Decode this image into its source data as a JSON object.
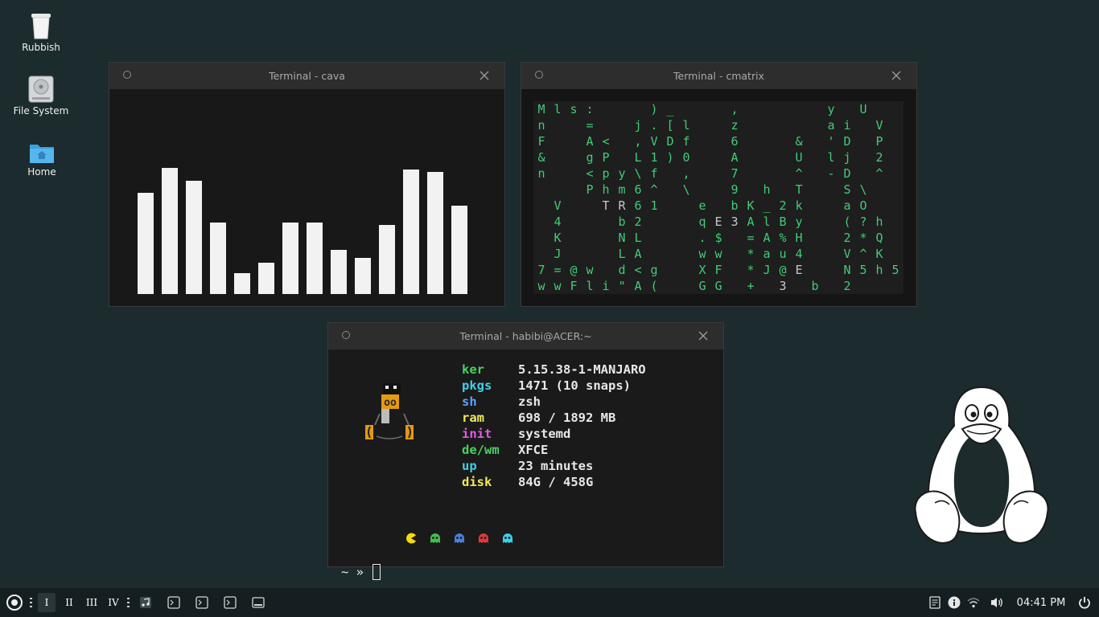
{
  "desktop": {
    "icons": [
      {
        "label": "Rubbish",
        "icon": "trash-icon"
      },
      {
        "label": "File System",
        "icon": "drive-icon"
      },
      {
        "label": "Home",
        "icon": "home-folder-icon"
      }
    ]
  },
  "windows": {
    "cava": {
      "title": "Terminal - cava",
      "bar_levels": [
        0.48,
        0.6,
        0.54,
        0.34,
        0.1,
        0.15,
        0.34,
        0.34,
        0.21,
        0.17,
        0.33,
        0.59,
        0.58,
        0.42
      ]
    },
    "cmatrix": {
      "title": "Terminal - cmatrix",
      "rows": [
        "Mls:   )_   ,     y U",
        "n  =  j.[l  z     ai V",
        "F  A< ,VDf  6   & 'D P",
        "&  gP L1)0  A   U lj 2",
        "n  <py\\f ,  7   ^ -D ^",
        "   Phm6^ \\  9 h T  S\\",
        " V  TR61  e bK_2k  aO",
        " 4   b2   qE3AlBy  (?h",
        " K   NL   .$ =A%H  2*Q",
        " J   LA   ww *au4  V^K",
        "7=@w d<g  XF *J@E  N5h5",
        "wwFli\"A(  GG + 3 b 2"
      ]
    },
    "fetch": {
      "title": "Terminal - habibi@ACER:~",
      "rows": [
        {
          "key": "ker",
          "value": "5.15.38-1-MANJARO",
          "color": "#48d160"
        },
        {
          "key": "pkgs",
          "value": "1471 (10 snaps)",
          "color": "#43cfe6"
        },
        {
          "key": "sh",
          "value": "zsh",
          "color": "#5aa2ff"
        },
        {
          "key": "ram",
          "value": "698 / 1892 MB",
          "color": "#f2e85c"
        },
        {
          "key": "init",
          "value": "systemd",
          "color": "#e05ce0"
        },
        {
          "key": "de/wm",
          "value": "XFCE",
          "color": "#48d160"
        },
        {
          "key": "up",
          "value": "23 minutes",
          "color": "#43cfe6"
        },
        {
          "key": "disk",
          "value": "84G / 458G",
          "color": "#f2e85c"
        }
      ],
      "ascii_eyes": "oo",
      "prompt": "~ »",
      "ghost_colors": [
        "#f5d90a",
        "#3fbf4f",
        "#4a80d9",
        "#e0393e",
        "#3ad1e8"
      ]
    }
  },
  "taskbar": {
    "workspaces": [
      "I",
      "II",
      "III",
      "IV"
    ],
    "apps": [
      "music-player-icon",
      "terminal-icon",
      "terminal-icon",
      "terminal-icon",
      "window-icon"
    ],
    "tray": [
      "notes-icon",
      "info-icon",
      "wifi-icon",
      "volume-icon"
    ],
    "clock": "04:41 PM"
  },
  "colors": {
    "desktop_bg": "#1c2b2d",
    "matrix_green": "#3fce73",
    "titlebar": "#2d2d2d"
  }
}
